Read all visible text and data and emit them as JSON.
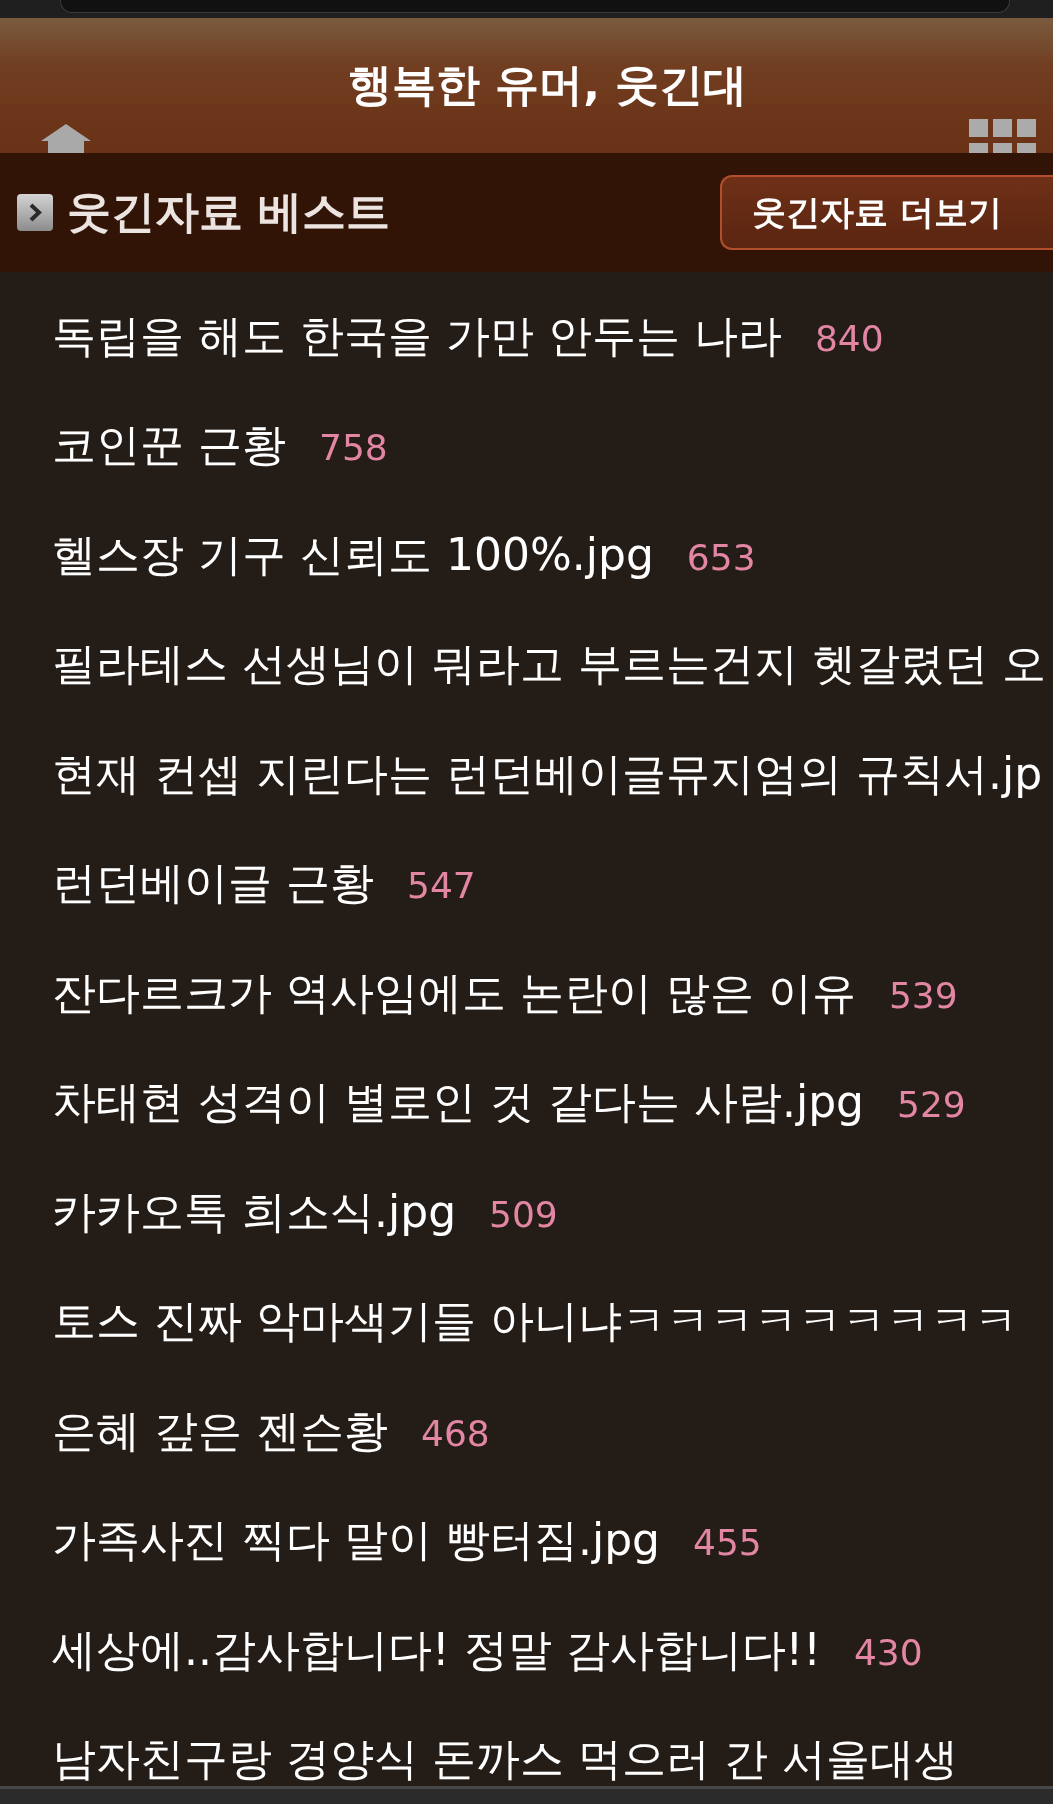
{
  "header": {
    "title": "행복한 유머, 웃긴대"
  },
  "section": {
    "title": "웃긴자료 베스트",
    "more_button": "웃긴자료 더보기"
  },
  "posts": [
    {
      "title": "독립을 해도 한국을 가만 안두는 나라",
      "count": "840"
    },
    {
      "title": "코인꾼 근황",
      "count": "758"
    },
    {
      "title": "헬스장 기구 신뢰도 100%.jpg",
      "count": "653"
    },
    {
      "title": "필라테스 선생님이 뭐라고 부르는건지 헷갈렸던 오"
    },
    {
      "title": "현재 컨셉 지린다는 런던베이글뮤지엄의 규칙서.jp"
    },
    {
      "title": "런던베이글 근황",
      "count": "547"
    },
    {
      "title": "잔다르크가 역사임에도 논란이 많은 이유",
      "count": "539"
    },
    {
      "title": "차태현 성격이 별로인 것 같다는 사람.jpg",
      "count": "529"
    },
    {
      "title": "카카오톡 희소식.jpg",
      "count": "509"
    },
    {
      "title": "토스 진짜 악마색기들 아니냐ㅋㅋㅋㅋㅋㅋㅋㅋㅋ"
    },
    {
      "title": "은혜 갚은 젠슨황",
      "count": "468"
    },
    {
      "title": "가족사진 찍다 말이 빵터짐.jpg",
      "count": "455"
    },
    {
      "title": "세상에..감사합니다! 정말 감사합니다!!",
      "count": "430"
    },
    {
      "title": "남자친구랑 경양식 돈까스 먹으러 간 서울대생"
    }
  ]
}
